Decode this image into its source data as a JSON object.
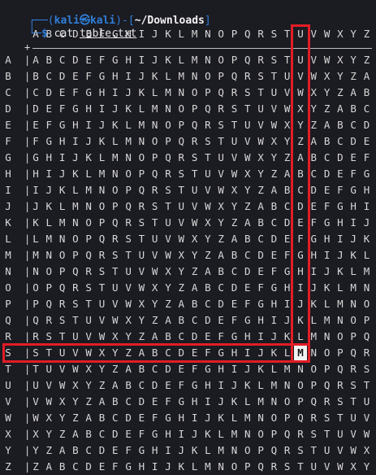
{
  "prompt": {
    "open": "┌──(",
    "user": "kali",
    "at_symbol": "㉿",
    "host": "kali",
    "close": ")-[",
    "path": "~/Downloads",
    "end": "]",
    "line2_prefix": "└─",
    "dollar": "$",
    "command": "cat",
    "argument": "table.txt"
  },
  "table": {
    "header": [
      "A",
      "B",
      "C",
      "D",
      "E",
      "F",
      "G",
      "H",
      "I",
      "J",
      "K",
      "L",
      "M",
      "N",
      "O",
      "P",
      "Q",
      "R",
      "S",
      "T",
      "U",
      "V",
      "W",
      "X",
      "Y",
      "Z"
    ],
    "plus": "+",
    "row_separator": "|",
    "rows": [
      {
        "key": "A",
        "cells": [
          "A",
          "B",
          "C",
          "D",
          "E",
          "F",
          "G",
          "H",
          "I",
          "J",
          "K",
          "L",
          "M",
          "N",
          "O",
          "P",
          "Q",
          "R",
          "S",
          "T",
          "U",
          "V",
          "W",
          "X",
          "Y",
          "Z"
        ]
      },
      {
        "key": "B",
        "cells": [
          "B",
          "C",
          "D",
          "E",
          "F",
          "G",
          "H",
          "I",
          "J",
          "K",
          "L",
          "M",
          "N",
          "O",
          "P",
          "Q",
          "R",
          "S",
          "T",
          "U",
          "V",
          "W",
          "X",
          "Y",
          "Z",
          "A"
        ]
      },
      {
        "key": "C",
        "cells": [
          "C",
          "D",
          "E",
          "F",
          "G",
          "H",
          "I",
          "J",
          "K",
          "L",
          "M",
          "N",
          "O",
          "P",
          "Q",
          "R",
          "S",
          "T",
          "U",
          "V",
          "W",
          "X",
          "Y",
          "Z",
          "A",
          "B"
        ]
      },
      {
        "key": "D",
        "cells": [
          "D",
          "E",
          "F",
          "G",
          "H",
          "I",
          "J",
          "K",
          "L",
          "M",
          "N",
          "O",
          "P",
          "Q",
          "R",
          "S",
          "T",
          "U",
          "V",
          "W",
          "X",
          "Y",
          "Z",
          "A",
          "B",
          "C"
        ]
      },
      {
        "key": "E",
        "cells": [
          "E",
          "F",
          "G",
          "H",
          "I",
          "J",
          "K",
          "L",
          "M",
          "N",
          "O",
          "P",
          "Q",
          "R",
          "S",
          "T",
          "U",
          "V",
          "W",
          "X",
          "Y",
          "Z",
          "A",
          "B",
          "C",
          "D"
        ]
      },
      {
        "key": "F",
        "cells": [
          "F",
          "G",
          "H",
          "I",
          "J",
          "K",
          "L",
          "M",
          "N",
          "O",
          "P",
          "Q",
          "R",
          "S",
          "T",
          "U",
          "V",
          "W",
          "X",
          "Y",
          "Z",
          "A",
          "B",
          "C",
          "D",
          "E"
        ]
      },
      {
        "key": "G",
        "cells": [
          "G",
          "H",
          "I",
          "J",
          "K",
          "L",
          "M",
          "N",
          "O",
          "P",
          "Q",
          "R",
          "S",
          "T",
          "U",
          "V",
          "W",
          "X",
          "Y",
          "Z",
          "A",
          "B",
          "C",
          "D",
          "E",
          "F"
        ]
      },
      {
        "key": "H",
        "cells": [
          "H",
          "I",
          "J",
          "K",
          "L",
          "M",
          "N",
          "O",
          "P",
          "Q",
          "R",
          "S",
          "T",
          "U",
          "V",
          "W",
          "X",
          "Y",
          "Z",
          "A",
          "B",
          "C",
          "D",
          "E",
          "F",
          "G"
        ]
      },
      {
        "key": "I",
        "cells": [
          "I",
          "J",
          "K",
          "L",
          "M",
          "N",
          "O",
          "P",
          "Q",
          "R",
          "S",
          "T",
          "U",
          "V",
          "W",
          "X",
          "Y",
          "Z",
          "A",
          "B",
          "C",
          "D",
          "E",
          "F",
          "G",
          "H"
        ]
      },
      {
        "key": "J",
        "cells": [
          "J",
          "K",
          "L",
          "M",
          "N",
          "O",
          "P",
          "Q",
          "R",
          "S",
          "T",
          "U",
          "V",
          "W",
          "X",
          "Y",
          "Z",
          "A",
          "B",
          "C",
          "D",
          "E",
          "F",
          "G",
          "H",
          "I"
        ]
      },
      {
        "key": "K",
        "cells": [
          "K",
          "L",
          "M",
          "N",
          "O",
          "P",
          "Q",
          "R",
          "S",
          "T",
          "U",
          "V",
          "W",
          "X",
          "Y",
          "Z",
          "A",
          "B",
          "C",
          "D",
          "E",
          "F",
          "G",
          "H",
          "I",
          "J"
        ]
      },
      {
        "key": "L",
        "cells": [
          "L",
          "M",
          "N",
          "O",
          "P",
          "Q",
          "R",
          "S",
          "T",
          "U",
          "V",
          "W",
          "X",
          "Y",
          "Z",
          "A",
          "B",
          "C",
          "D",
          "E",
          "F",
          "G",
          "H",
          "I",
          "J",
          "K"
        ]
      },
      {
        "key": "M",
        "cells": [
          "M",
          "N",
          "O",
          "P",
          "Q",
          "R",
          "S",
          "T",
          "U",
          "V",
          "W",
          "X",
          "Y",
          "Z",
          "A",
          "B",
          "C",
          "D",
          "E",
          "F",
          "G",
          "H",
          "I",
          "J",
          "K",
          "L"
        ]
      },
      {
        "key": "N",
        "cells": [
          "N",
          "O",
          "P",
          "Q",
          "R",
          "S",
          "T",
          "U",
          "V",
          "W",
          "X",
          "Y",
          "Z",
          "A",
          "B",
          "C",
          "D",
          "E",
          "F",
          "G",
          "H",
          "I",
          "J",
          "K",
          "L",
          "M"
        ]
      },
      {
        "key": "O",
        "cells": [
          "O",
          "P",
          "Q",
          "R",
          "S",
          "T",
          "U",
          "V",
          "W",
          "X",
          "Y",
          "Z",
          "A",
          "B",
          "C",
          "D",
          "E",
          "F",
          "G",
          "H",
          "I",
          "J",
          "K",
          "L",
          "M",
          "N"
        ]
      },
      {
        "key": "P",
        "cells": [
          "P",
          "Q",
          "R",
          "S",
          "T",
          "U",
          "V",
          "W",
          "X",
          "Y",
          "Z",
          "A",
          "B",
          "C",
          "D",
          "E",
          "F",
          "G",
          "H",
          "I",
          "J",
          "K",
          "L",
          "M",
          "N",
          "O"
        ]
      },
      {
        "key": "Q",
        "cells": [
          "Q",
          "R",
          "S",
          "T",
          "U",
          "V",
          "W",
          "X",
          "Y",
          "Z",
          "A",
          "B",
          "C",
          "D",
          "E",
          "F",
          "G",
          "H",
          "I",
          "J",
          "K",
          "L",
          "M",
          "N",
          "O",
          "P"
        ]
      },
      {
        "key": "R",
        "cells": [
          "R",
          "S",
          "T",
          "U",
          "V",
          "W",
          "X",
          "Y",
          "Z",
          "A",
          "B",
          "C",
          "D",
          "E",
          "F",
          "G",
          "H",
          "I",
          "J",
          "K",
          "L",
          "M",
          "N",
          "O",
          "P",
          "Q"
        ]
      },
      {
        "key": "S",
        "cells": [
          "S",
          "T",
          "U",
          "V",
          "W",
          "X",
          "Y",
          "Z",
          "A",
          "B",
          "C",
          "D",
          "E",
          "F",
          "G",
          "H",
          "I",
          "J",
          "K",
          "L",
          "M",
          "N",
          "O",
          "P",
          "Q",
          "R"
        ]
      },
      {
        "key": "T",
        "cells": [
          "T",
          "U",
          "V",
          "W",
          "X",
          "Y",
          "Z",
          "A",
          "B",
          "C",
          "D",
          "E",
          "F",
          "G",
          "H",
          "I",
          "J",
          "K",
          "L",
          "M",
          "N",
          "O",
          "P",
          "Q",
          "R",
          "S"
        ]
      },
      {
        "key": "U",
        "cells": [
          "U",
          "V",
          "W",
          "X",
          "Y",
          "Z",
          "A",
          "B",
          "C",
          "D",
          "E",
          "F",
          "G",
          "H",
          "I",
          "J",
          "K",
          "L",
          "M",
          "N",
          "O",
          "P",
          "Q",
          "R",
          "S",
          "T"
        ]
      },
      {
        "key": "V",
        "cells": [
          "V",
          "W",
          "X",
          "Y",
          "Z",
          "A",
          "B",
          "C",
          "D",
          "E",
          "F",
          "G",
          "H",
          "I",
          "J",
          "K",
          "L",
          "M",
          "N",
          "O",
          "P",
          "Q",
          "R",
          "S",
          "T",
          "U"
        ]
      },
      {
        "key": "W",
        "cells": [
          "W",
          "X",
          "Y",
          "Z",
          "A",
          "B",
          "C",
          "D",
          "E",
          "F",
          "G",
          "H",
          "I",
          "J",
          "K",
          "L",
          "M",
          "N",
          "O",
          "P",
          "Q",
          "R",
          "S",
          "T",
          "U",
          "V"
        ]
      },
      {
        "key": "X",
        "cells": [
          "X",
          "Y",
          "Z",
          "A",
          "B",
          "C",
          "D",
          "E",
          "F",
          "G",
          "H",
          "I",
          "J",
          "K",
          "L",
          "M",
          "N",
          "O",
          "P",
          "Q",
          "R",
          "S",
          "T",
          "U",
          "V",
          "W"
        ]
      },
      {
        "key": "Y",
        "cells": [
          "Y",
          "Z",
          "A",
          "B",
          "C",
          "D",
          "E",
          "F",
          "G",
          "H",
          "I",
          "J",
          "K",
          "L",
          "M",
          "N",
          "O",
          "P",
          "Q",
          "R",
          "S",
          "T",
          "U",
          "V",
          "W",
          "X"
        ]
      },
      {
        "key": "Z",
        "cells": [
          "Z",
          "A",
          "B",
          "C",
          "D",
          "E",
          "F",
          "G",
          "H",
          "I",
          "J",
          "K",
          "L",
          "M",
          "N",
          "O",
          "P",
          "Q",
          "R",
          "S",
          "T",
          "U",
          "V",
          "W",
          "X",
          "Y"
        ]
      }
    ],
    "highlight": {
      "column_letter": "U",
      "row_letter": "S",
      "intersection": "M",
      "box_color": "#e11d25"
    }
  },
  "colors": {
    "background": "#1b1b22",
    "prompt_blue": "#2f7fd8",
    "text": "#d8d8d8"
  }
}
